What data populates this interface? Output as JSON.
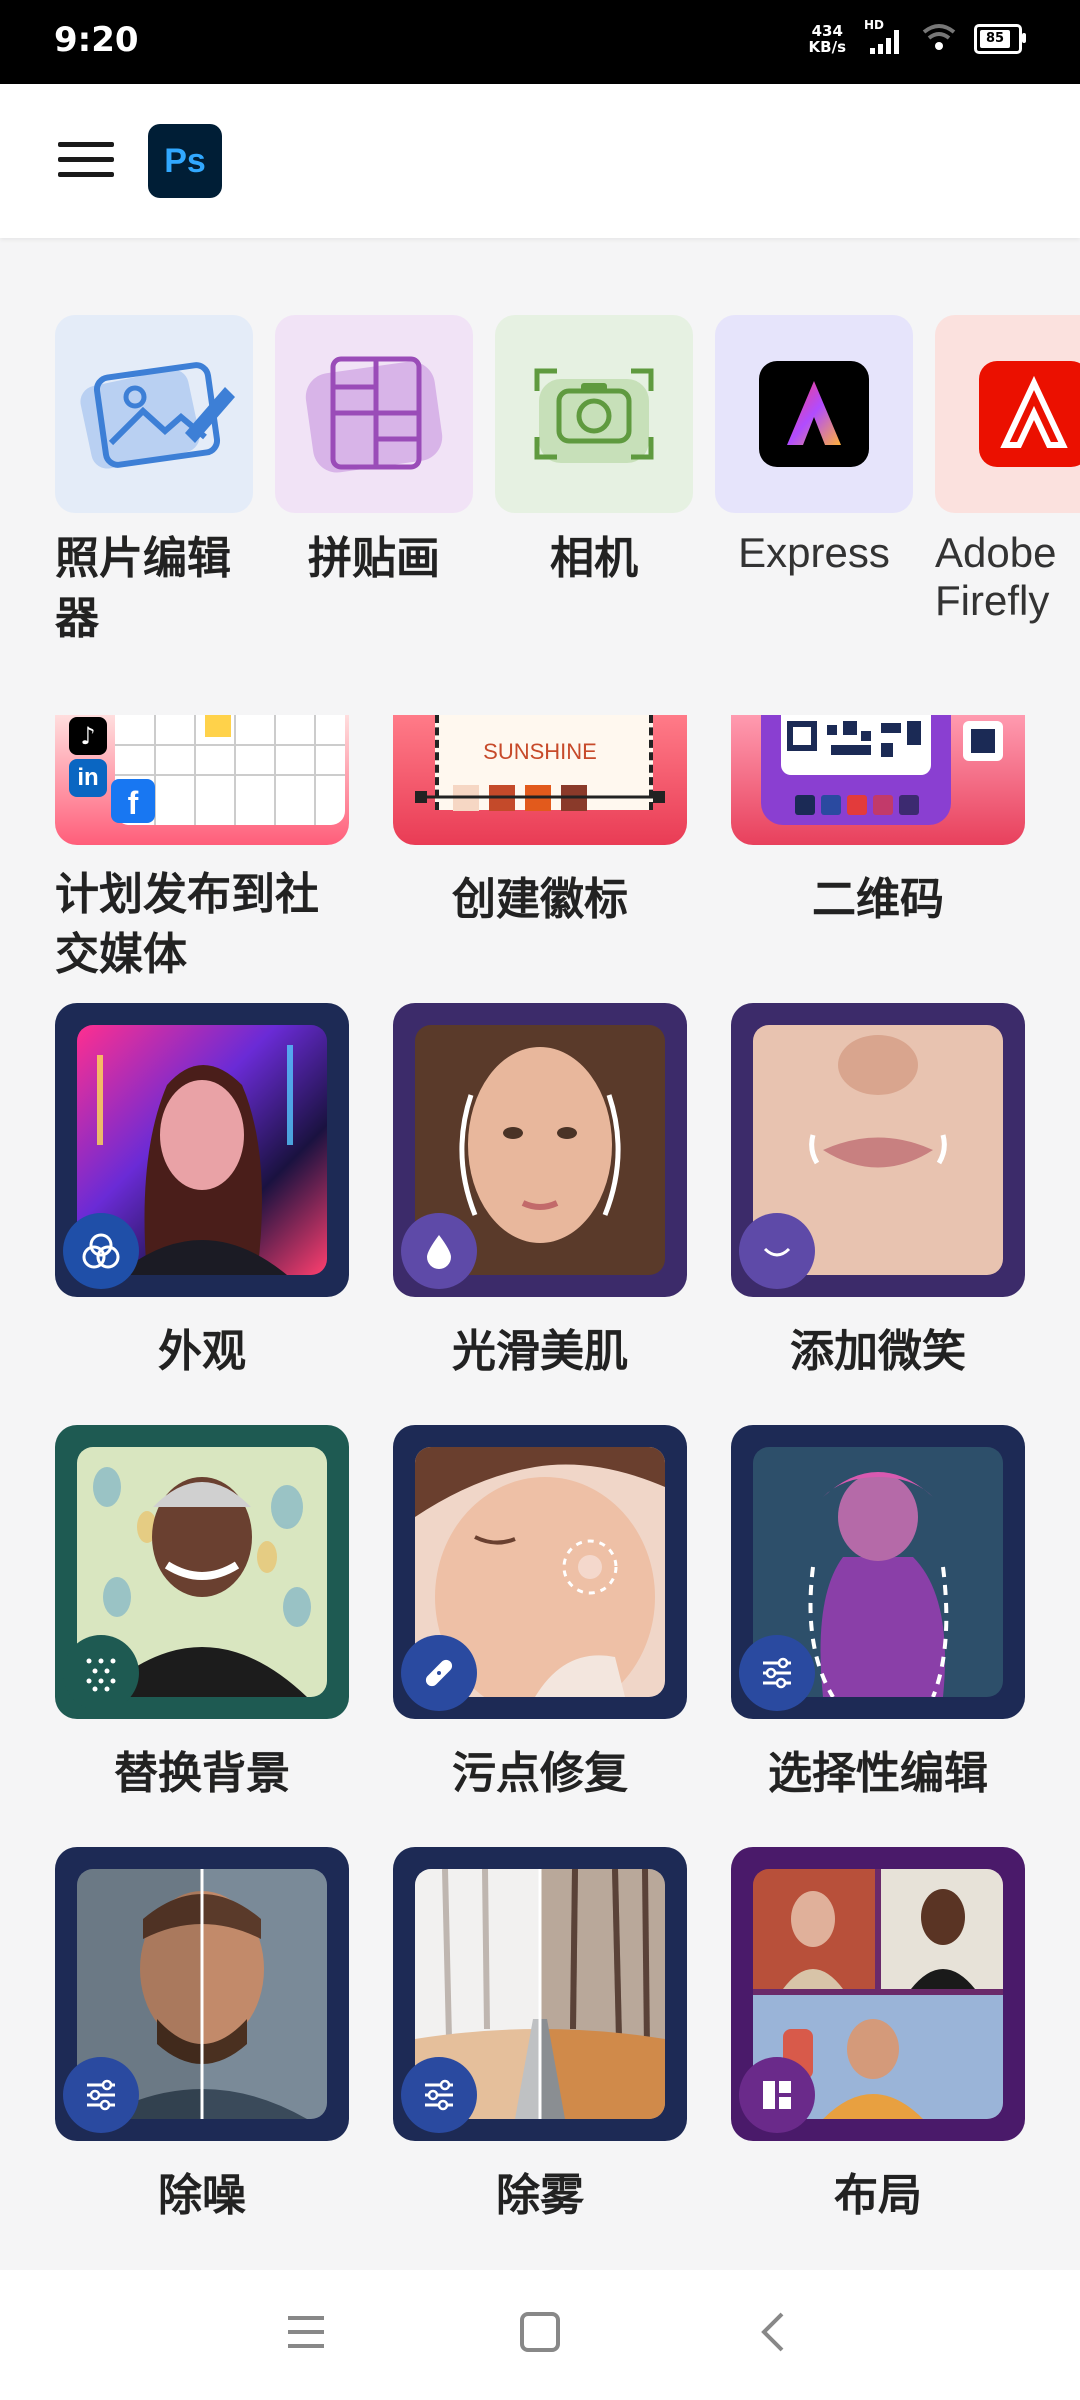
{
  "status_bar": {
    "time": "9:20",
    "net_speed_value": "434",
    "net_speed_unit": "KB/s",
    "signal_label": "HD",
    "battery": "85"
  },
  "app_bar": {
    "logo_text": "Ps"
  },
  "quick_actions": [
    {
      "label": "照片编辑器"
    },
    {
      "label": "拼贴画"
    },
    {
      "label": "相机"
    },
    {
      "label": "Express"
    },
    {
      "label": "Adobe Firefly"
    }
  ],
  "cut_cards": [
    {
      "label": "计划发布到社交媒体",
      "inner_text": ""
    },
    {
      "label": "创建徽标",
      "inner_text": "SUNSHINE"
    },
    {
      "label": "二维码",
      "inner_text": ""
    }
  ],
  "feature_cards": [
    {
      "label": "外观"
    },
    {
      "label": "光滑美肌"
    },
    {
      "label": "添加微笑"
    },
    {
      "label": "替换背景"
    },
    {
      "label": "污点修复"
    },
    {
      "label": "选择性编辑"
    },
    {
      "label": "除噪"
    },
    {
      "label": "除雾"
    },
    {
      "label": "布局"
    }
  ],
  "colors": {
    "accent": "#31a8ff",
    "card_dark": "#1d2a55",
    "card_purple": "#3c2b6a"
  }
}
